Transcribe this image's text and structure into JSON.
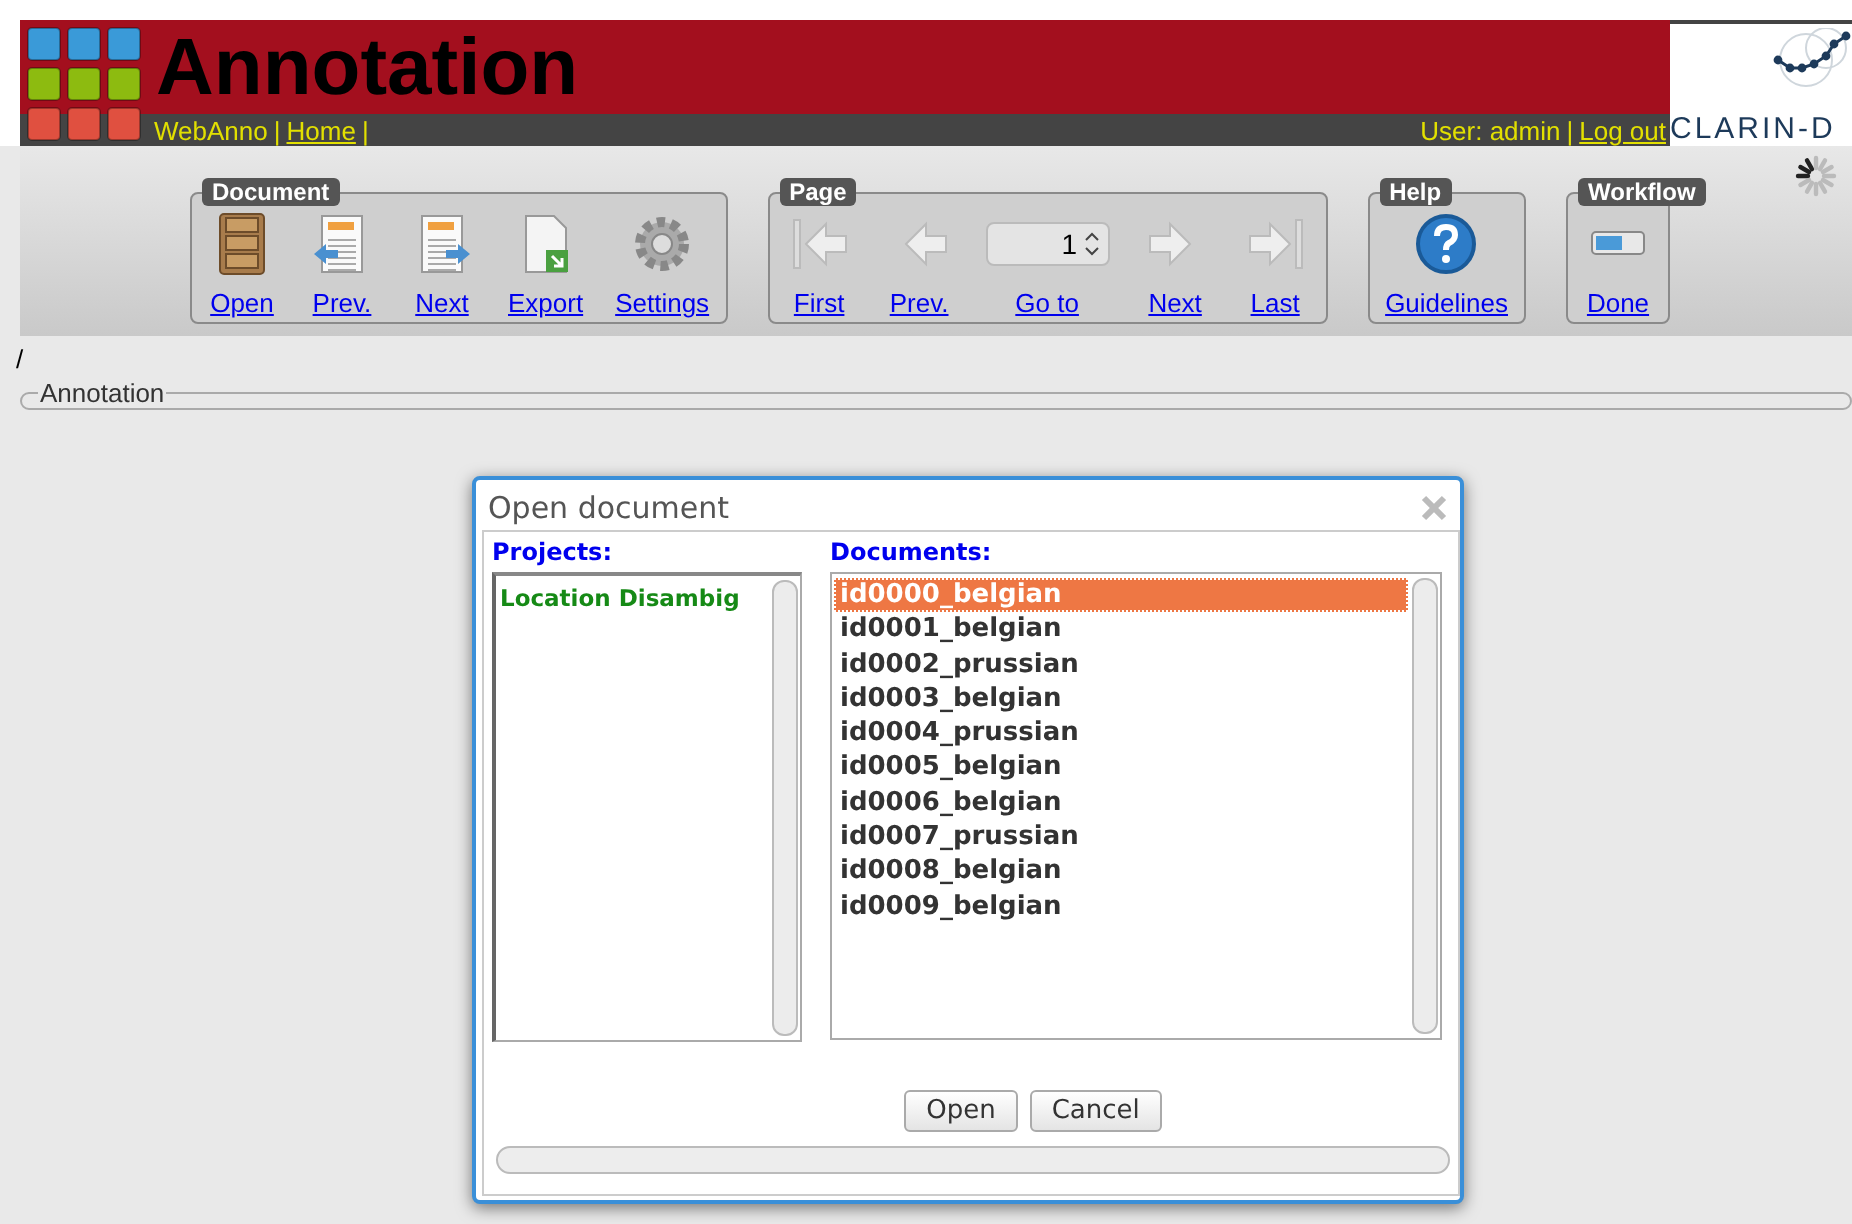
{
  "header": {
    "title": "Annotation",
    "app_name": "WebAnno",
    "separator": "|",
    "home": "Home",
    "home_separator": "|",
    "user": "User: admin",
    "user_separator": "|",
    "logout": "Log out",
    "logo_text": "CLARIN-D"
  },
  "toolbar": [
    {
      "title": "Document",
      "items": [
        {
          "label": "Open"
        },
        {
          "label": "Prev."
        },
        {
          "label": "Next"
        },
        {
          "label": "Export"
        },
        {
          "label": "Settings"
        }
      ]
    },
    {
      "title": "Page",
      "items": [
        {
          "label": "First"
        },
        {
          "label": "Prev."
        },
        {
          "label": "Go to",
          "value": "1"
        },
        {
          "label": "Next"
        },
        {
          "label": "Last"
        }
      ]
    },
    {
      "title": "Help",
      "items": [
        {
          "label": "Guidelines"
        }
      ]
    },
    {
      "title": "Workflow",
      "items": [
        {
          "label": "Done"
        }
      ]
    }
  ],
  "breadcrumb": "/",
  "annotation_panel": {
    "legend": "Annotation"
  },
  "dialog": {
    "title": "Open document",
    "projects_label": "Projects:",
    "projects": [
      {
        "name": "Location Disambig",
        "selected": false
      }
    ],
    "documents_label": "Documents:",
    "documents": [
      {
        "name": "id0000_belgian",
        "selected": true
      },
      {
        "name": "id0001_belgian",
        "selected": false
      },
      {
        "name": "id0002_prussian",
        "selected": false
      },
      {
        "name": "id0003_belgian",
        "selected": false
      },
      {
        "name": "id0004_prussian",
        "selected": false
      },
      {
        "name": "id0005_belgian",
        "selected": false
      },
      {
        "name": "id0006_belgian",
        "selected": false
      },
      {
        "name": "id0007_prussian",
        "selected": false
      },
      {
        "name": "id0008_belgian",
        "selected": false
      },
      {
        "name": "id0009_belgian",
        "selected": false
      }
    ],
    "buttons": [
      "Open",
      "Cancel"
    ]
  }
}
